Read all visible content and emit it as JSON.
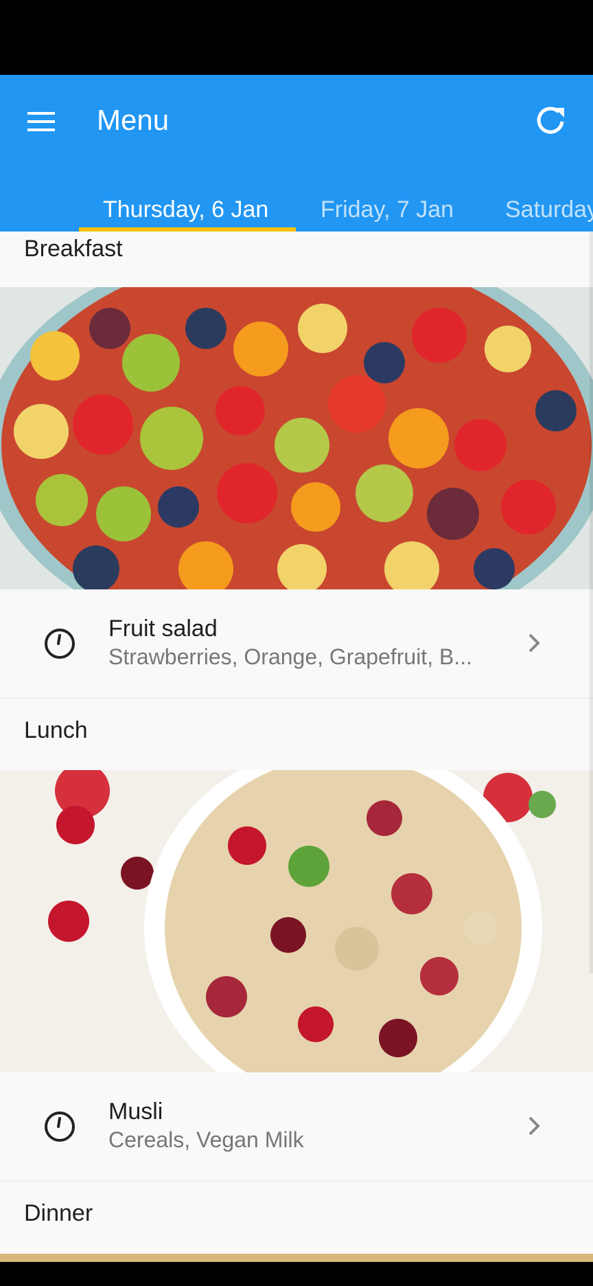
{
  "app_bar": {
    "title": "Menu",
    "menu_icon": "hamburger-menu-icon",
    "refresh_icon": "refresh-icon",
    "color": "#2196f3"
  },
  "tabs": [
    {
      "label": "Thursday, 6 Jan",
      "active": true
    },
    {
      "label": "Friday, 7 Jan",
      "active": false
    },
    {
      "label": "Saturday",
      "active": false
    }
  ],
  "tab_indicator_color": "#ffc107",
  "sections": [
    {
      "title": "Breakfast",
      "meal": {
        "name": "Fruit salad",
        "description": "Strawberries, Orange, Grapefruit, B...",
        "icon": "clock-icon"
      }
    },
    {
      "title": "Lunch",
      "meal": {
        "name": "Musli",
        "description": "Cereals, Vegan Milk",
        "icon": "clock-icon"
      }
    },
    {
      "title": "Dinner"
    }
  ]
}
